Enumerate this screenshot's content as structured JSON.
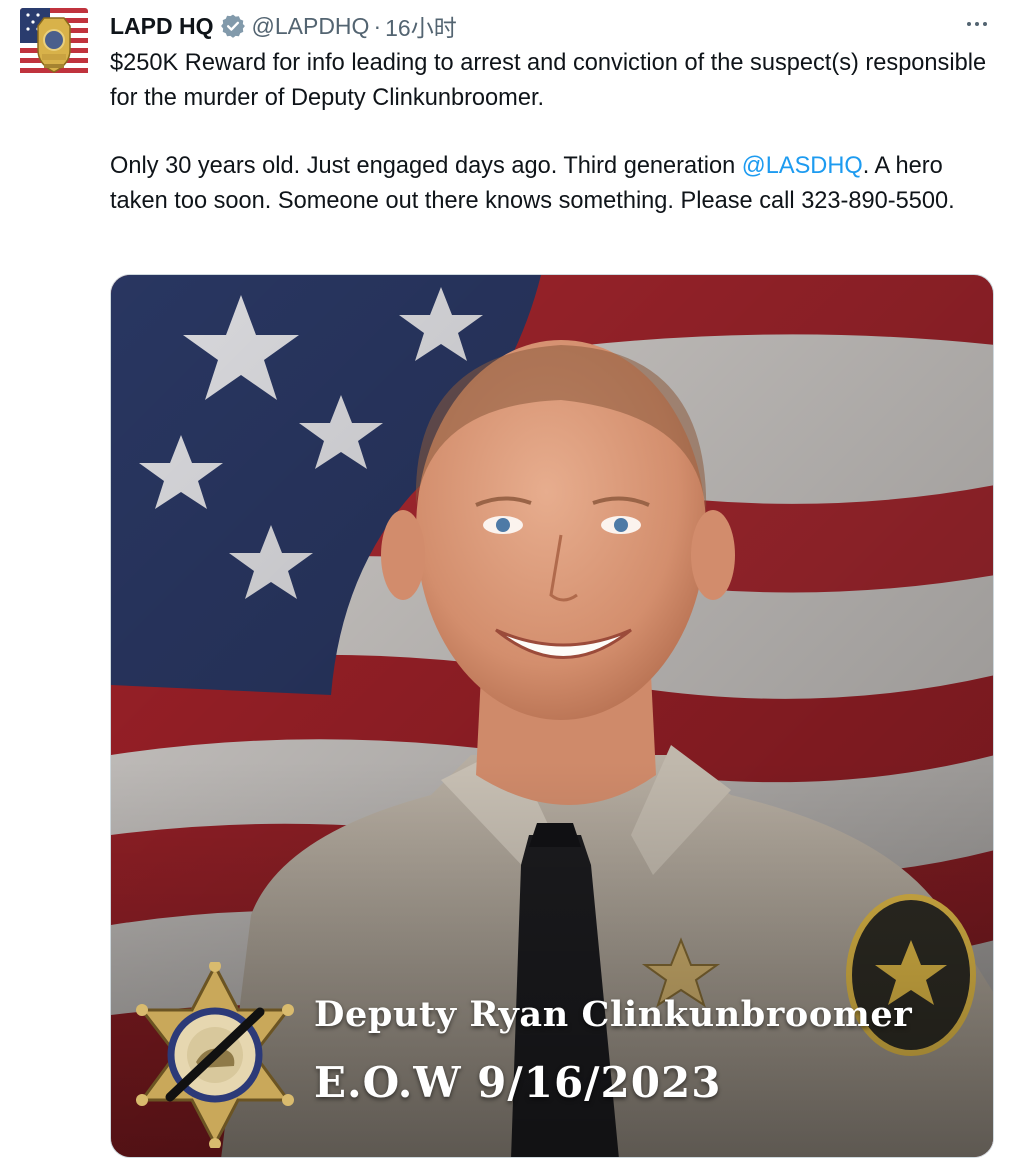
{
  "tweet": {
    "display_name": "LAPD HQ",
    "handle": "@LAPDHQ",
    "separator": "·",
    "time": "16小时",
    "paragraph1": "$250K Reward for info leading to arrest and conviction of the suspect(s) responsible for the murder of Deputy Clinkunbroomer.",
    "paragraph2_before": "Only 30 years old. Just engaged days ago. Third generation ",
    "paragraph2_mention": "@LASDHQ",
    "paragraph2_after": ". A hero taken too soon.  Someone out there knows something. Please call 323-890-5500."
  },
  "media": {
    "caption_name": "Deputy Ryan Clinkunbroomer",
    "caption_eow": "E.O.W 9/16/2023"
  },
  "icons": {
    "verified": "verified-badge-icon",
    "more": "more-options-icon"
  },
  "colors": {
    "text": "#0f1419",
    "secondary": "#536471",
    "mention": "#1d9bf0",
    "verified": "#829aab"
  }
}
